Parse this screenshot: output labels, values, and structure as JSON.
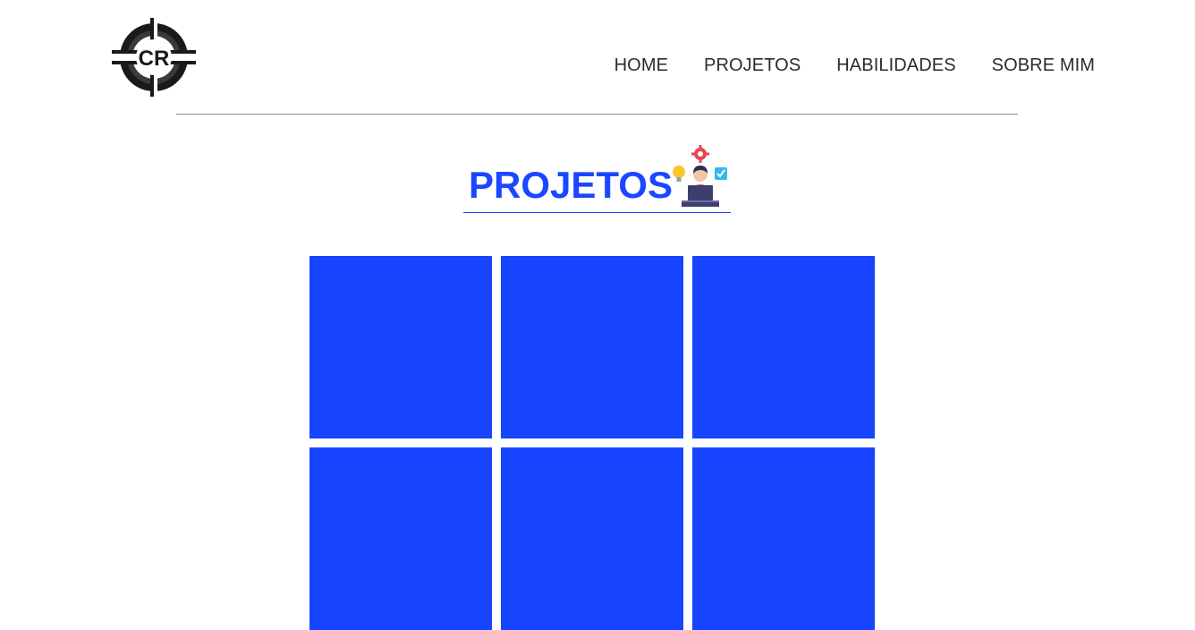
{
  "nav": {
    "items": [
      {
        "label": "HOME"
      },
      {
        "label": "PROJETOS"
      },
      {
        "label": "HABILIDADES"
      },
      {
        "label": "SOBRE MIM"
      }
    ]
  },
  "logo": {
    "text": "CR",
    "icon": "cr-logo-icon"
  },
  "section": {
    "title": "PROJETOS",
    "illustration_icon": "developer-at-laptop-icon"
  },
  "colors": {
    "accent": "#1a47ff",
    "card": "#1745ff",
    "nav_text": "#2b2b2b",
    "divider": "#8a8a8a"
  },
  "projects": {
    "count": 6
  }
}
